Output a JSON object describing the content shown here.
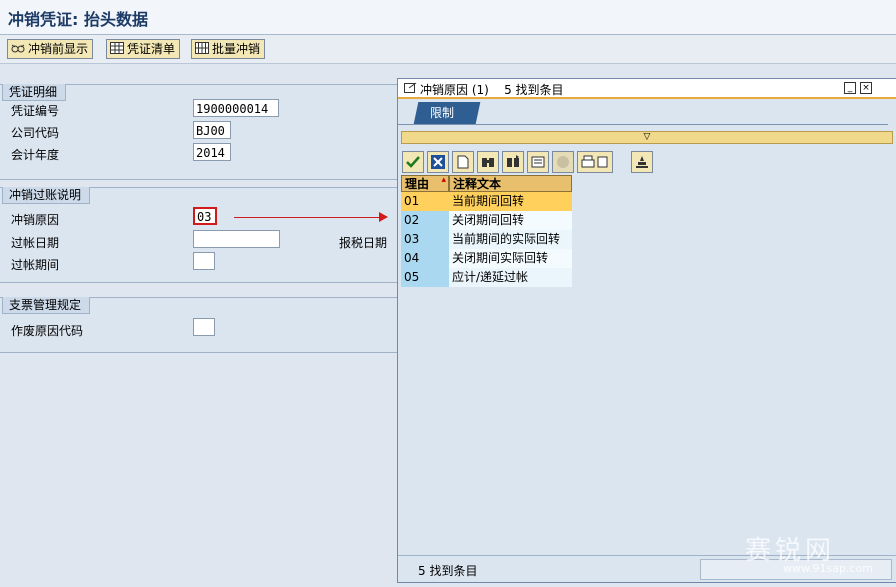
{
  "title": "冲销凭证: 抬头数据",
  "toolbar": {
    "display_before": "冲销前显示",
    "doc_list": "凭证清单",
    "batch_reverse": "批量冲销"
  },
  "group_doc": {
    "title": "凭证明细",
    "doc_no_label": "凭证编号",
    "doc_no_value": "1900000014",
    "company_label": "公司代码",
    "company_value": "BJ00",
    "year_label": "会计年度",
    "year_value": "2014"
  },
  "group_post": {
    "title": "冲销过账说明",
    "reason_label": "冲销原因",
    "reason_value": "03",
    "post_date_label": "过帐日期",
    "post_date_value": "",
    "tax_date_label": "报税日期",
    "period_label": "过帐期间",
    "period_value": ""
  },
  "group_check": {
    "title": "支票管理规定",
    "void_label": "作废原因代码",
    "void_value": ""
  },
  "popup": {
    "title": "冲销原因 (1)    5 找到条目",
    "tab": "限制",
    "col_reason": "理由",
    "col_text": "注释文本",
    "rows": [
      {
        "code": "01",
        "text": "当前期间回转"
      },
      {
        "code": "02",
        "text": "关闭期间回转"
      },
      {
        "code": "03",
        "text": "当前期间的实际回转"
      },
      {
        "code": "04",
        "text": "关闭期间实际回转"
      },
      {
        "code": "05",
        "text": "应计/递延过帐"
      }
    ],
    "status": "5 找到条目"
  },
  "watermark": {
    "cn": "赛锐网",
    "url": "www.91sap.com"
  }
}
